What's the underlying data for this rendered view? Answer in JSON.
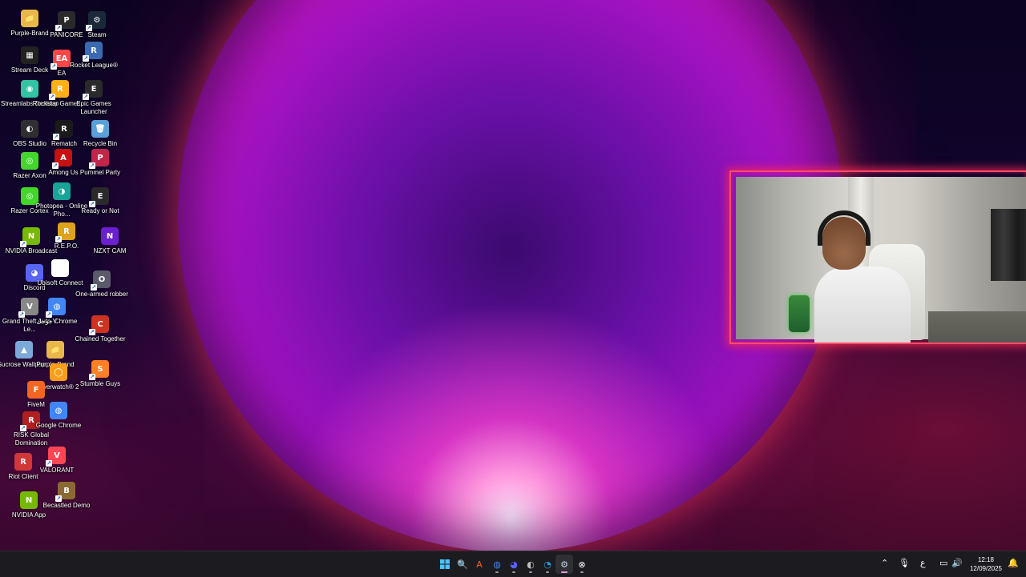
{
  "desktop": {
    "icons": [
      {
        "label": "Purple-Brand",
        "glyph": "📁",
        "color": "#e8b84a",
        "shortcut": false
      },
      {
        "label": "PANICORE",
        "glyph": "P",
        "color": "#2a2a2a",
        "shortcut": true
      },
      {
        "label": "Steam",
        "glyph": "⚙",
        "color": "#1b2838",
        "shortcut": true
      },
      {
        "label": "Stream Deck",
        "glyph": "▦",
        "color": "#222222",
        "shortcut": false
      },
      {
        "label": "EA",
        "glyph": "EA",
        "color": "#ff4747",
        "shortcut": true
      },
      {
        "label": "Rocket League®",
        "glyph": "R",
        "color": "#3a6ab0",
        "shortcut": true
      },
      {
        "label": "Streamlabs Desktop",
        "glyph": "◉",
        "color": "#31c3a2",
        "shortcut": false
      },
      {
        "label": "Rockstar Games ...",
        "glyph": "R",
        "color": "#fcaf17",
        "shortcut": true
      },
      {
        "label": "Epic Games Launcher",
        "glyph": "E",
        "color": "#2a2a2a",
        "shortcut": true
      },
      {
        "label": "OBS Studio",
        "glyph": "◐",
        "color": "#302e31",
        "shortcut": false
      },
      {
        "label": "Rematch",
        "glyph": "R",
        "color": "#1a1a1a",
        "shortcut": true
      },
      {
        "label": "Recycle Bin",
        "glyph": "🗑",
        "color": "#5aa0d8",
        "shortcut": false
      },
      {
        "label": "Razer Axon",
        "glyph": "◎",
        "color": "#44d62c",
        "shortcut": false
      },
      {
        "label": "Among Us",
        "glyph": "A",
        "color": "#c51111",
        "shortcut": true
      },
      {
        "label": "Pummel Party",
        "glyph": "P",
        "color": "#c0264a",
        "shortcut": true
      },
      {
        "label": "Razer Cortex",
        "glyph": "◎",
        "color": "#44d62c",
        "shortcut": false
      },
      {
        "label": "Photopea - Online Pho...",
        "glyph": "◑",
        "color": "#18a497",
        "shortcut": false
      },
      {
        "label": "Ready or Not",
        "glyph": "E",
        "color": "#2a2a2a",
        "shortcut": true
      },
      {
        "label": "NVIDIA Broadcast",
        "glyph": "N",
        "color": "#76b900",
        "shortcut": true
      },
      {
        "label": "R.E.P.O.",
        "glyph": "R",
        "color": "#e0a020",
        "shortcut": true
      },
      {
        "label": "NZXT CAM",
        "glyph": "N",
        "color": "#6a1fd0",
        "shortcut": false
      },
      {
        "label": "Discord",
        "glyph": "◕",
        "color": "#5865f2",
        "shortcut": false
      },
      {
        "label": "Ubisoft Connect",
        "glyph": "◌",
        "color": "#ffffff",
        "shortcut": false
      },
      {
        "label": "One-armed robber",
        "glyph": "O",
        "color": "#5a5a6a",
        "shortcut": true
      },
      {
        "label": "Grand Theft Auto V Le...",
        "glyph": "V",
        "color": "#888888",
        "shortcut": true
      },
      {
        "label": "جوجل Chrome",
        "glyph": "◍",
        "color": "#4285f4",
        "shortcut": true
      },
      {
        "label": "Chained Together",
        "glyph": "C",
        "color": "#cc3322",
        "shortcut": true
      },
      {
        "label": "Sucrose Wallpap...",
        "glyph": "▲",
        "color": "#7aa8d8",
        "shortcut": false
      },
      {
        "label": "Purple-Brand",
        "glyph": "📁",
        "color": "#e8b84a",
        "shortcut": false
      },
      {
        "label": "Overwatch® 2",
        "glyph": "◯",
        "color": "#f99e1a",
        "shortcut": false
      },
      {
        "label": "Stumble Guys",
        "glyph": "S",
        "color": "#ff7f27",
        "shortcut": true
      },
      {
        "label": "FiveM",
        "glyph": "F",
        "color": "#f26522",
        "shortcut": false
      },
      {
        "label": "RISK Global Domination",
        "glyph": "R",
        "color": "#b02020",
        "shortcut": true
      },
      {
        "label": "Google Chrome",
        "glyph": "◍",
        "color": "#4285f4",
        "shortcut": false
      },
      {
        "label": "Riot Client",
        "glyph": "R",
        "color": "#d13639",
        "shortcut": false
      },
      {
        "label": "VALORANT",
        "glyph": "V",
        "color": "#ff4655",
        "shortcut": true
      },
      {
        "label": "NVIDIA App",
        "glyph": "N",
        "color": "#76b900",
        "shortcut": false
      },
      {
        "label": "Becastled Demo",
        "glyph": "B",
        "color": "#8a6a30",
        "shortcut": true
      }
    ]
  },
  "webcam": {
    "border_color": "#ff4b6a"
  },
  "taskbar": {
    "start_icon": "windows-icon",
    "apps": [
      {
        "name": "search-icon",
        "glyph": "🔍",
        "color": "#ffffff"
      },
      {
        "name": "app-icon-orange",
        "glyph": "A",
        "color": "#f26522"
      },
      {
        "name": "chrome-icon",
        "glyph": "◍",
        "color": "#4285f4"
      },
      {
        "name": "discord-icon",
        "glyph": "◕",
        "color": "#5865f2"
      },
      {
        "name": "obs-icon",
        "glyph": "◐",
        "color": "#c0c0c0"
      },
      {
        "name": "edge-icon",
        "glyph": "◔",
        "color": "#2aa0e0"
      },
      {
        "name": "steam-icon",
        "glyph": "⚙",
        "color": "#c0d8f0"
      },
      {
        "name": "xbox-icon",
        "glyph": "⊗",
        "color": "#ffffff"
      }
    ],
    "tray": {
      "language": "ع",
      "time": "12:18",
      "date": "12/09/2025"
    }
  }
}
